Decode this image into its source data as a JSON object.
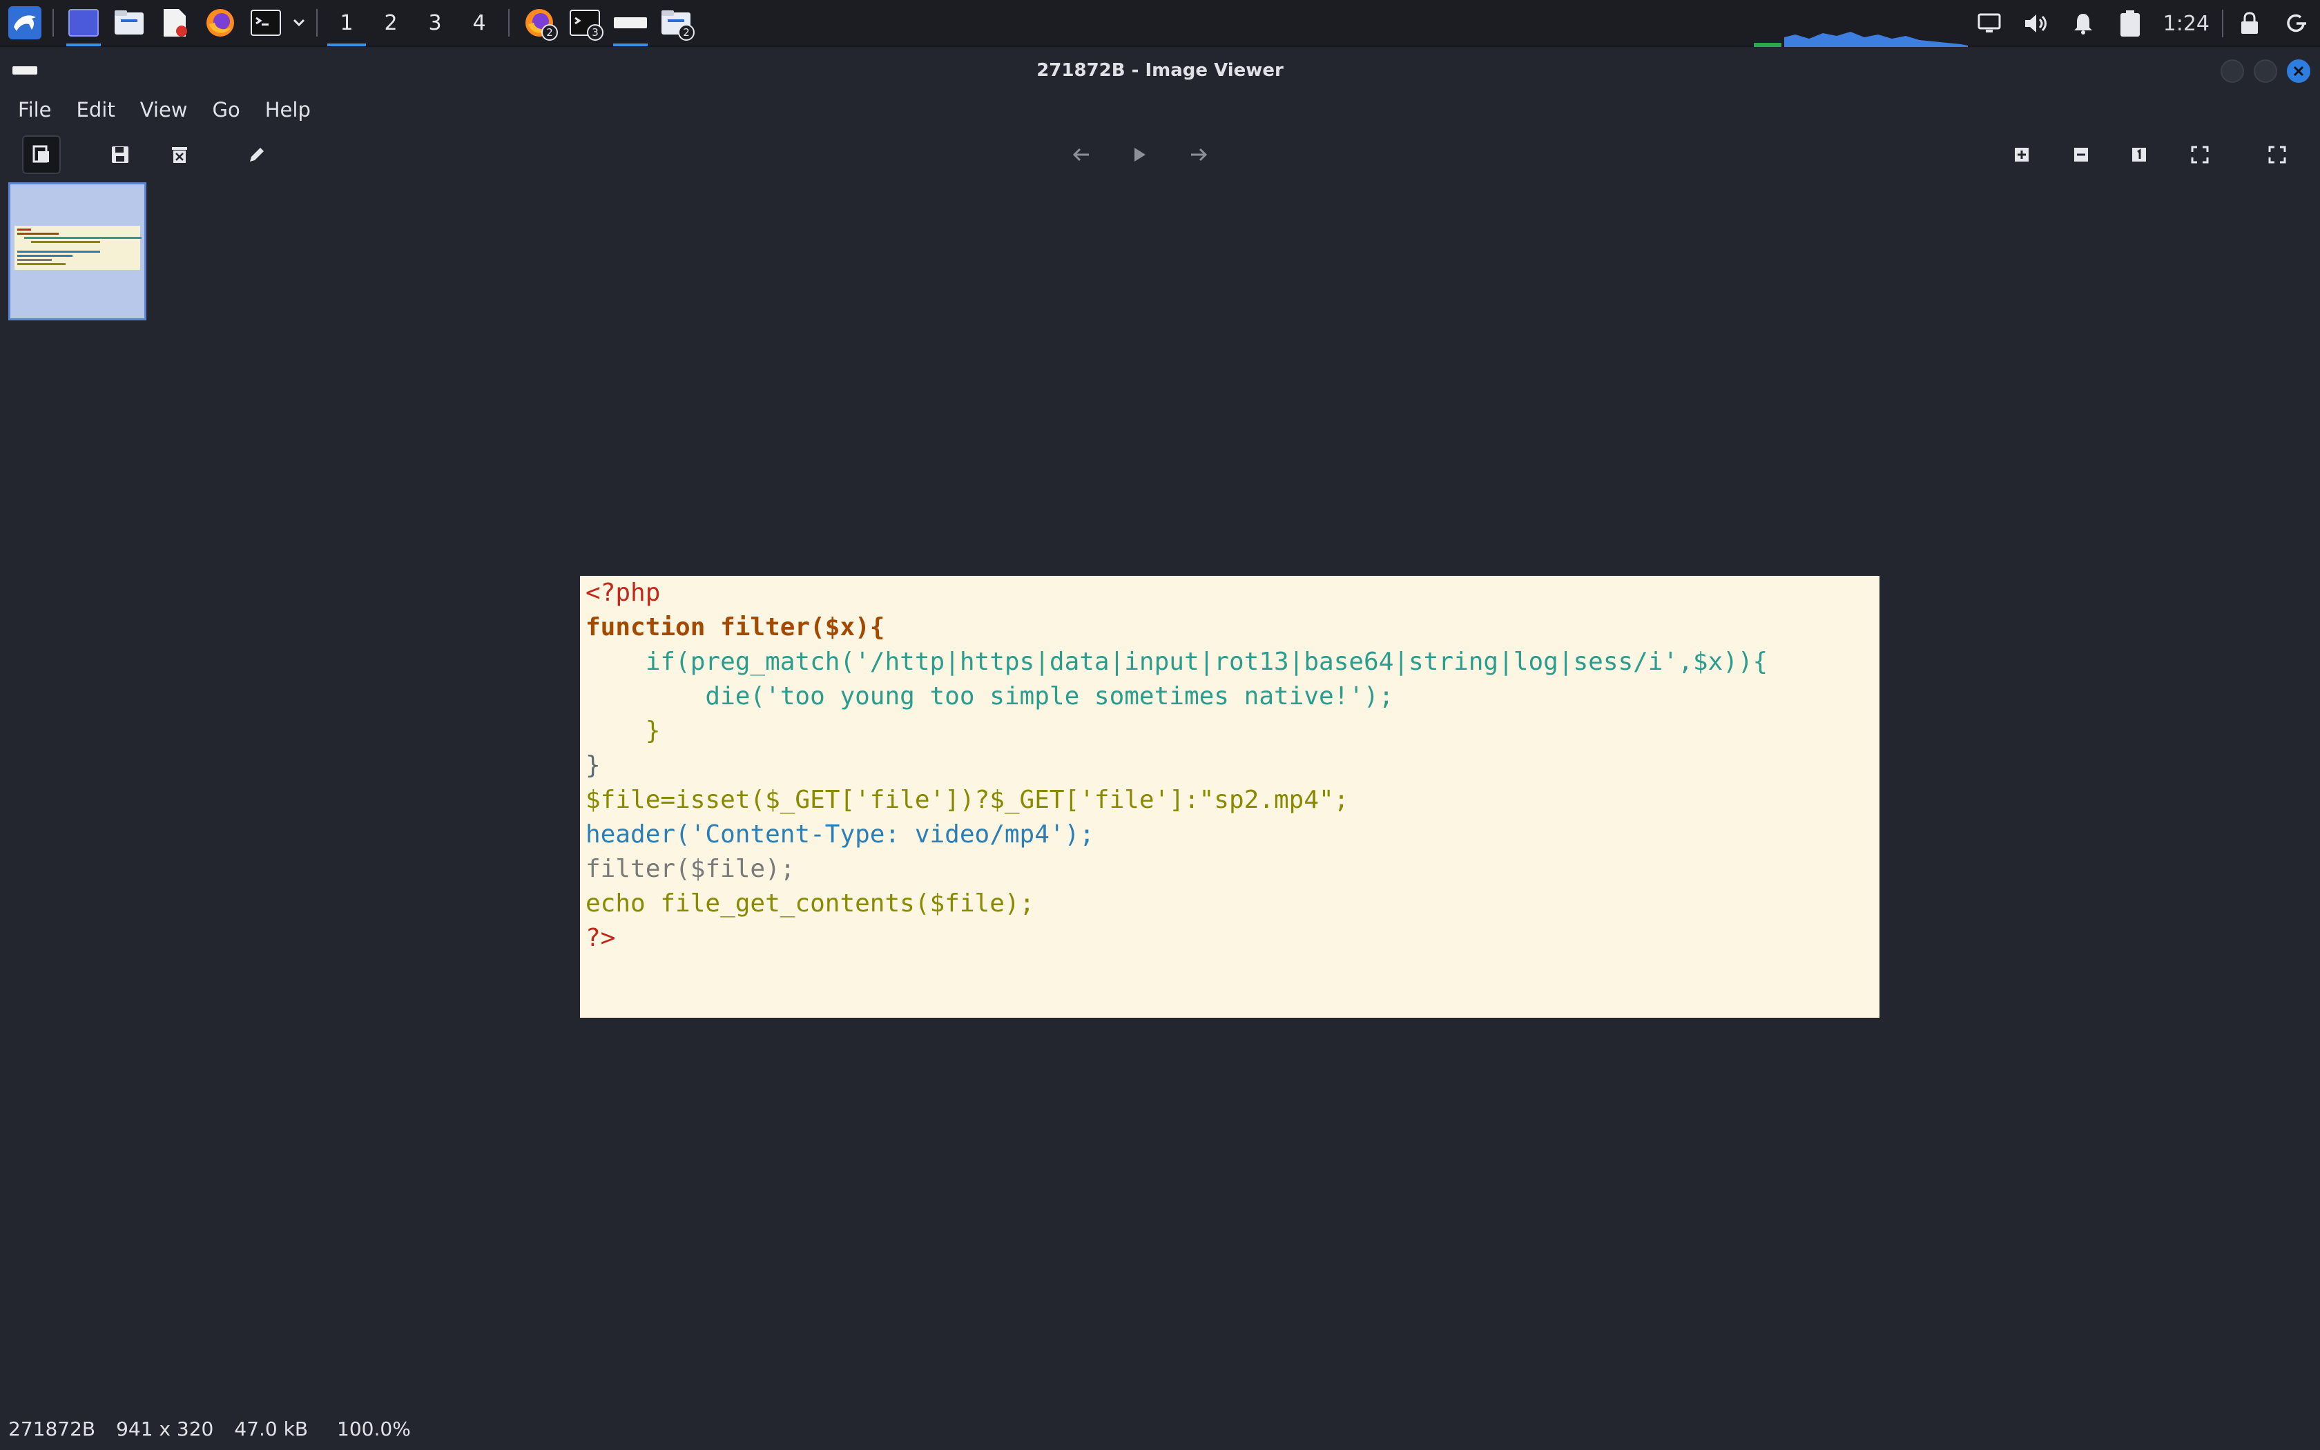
{
  "taskbar": {
    "workspaces": [
      "1",
      "2",
      "3",
      "4"
    ],
    "active_workspace": "1",
    "firefox_badge": "2",
    "terminal_badge": "3",
    "files_badge": "2",
    "clock": "1:24",
    "accent": "#3d8ee6"
  },
  "window": {
    "title": "271872B - Image Viewer"
  },
  "menu": {
    "items": [
      "File",
      "Edit",
      "View",
      "Go",
      "Help"
    ]
  },
  "code": {
    "lines": [
      "<?php",
      "function filter($x){",
      "    if(preg_match('/http|https|data|input|rot13|base64|string|log|sess/i',$x)){",
      "        die('too young too simple sometimes native!');",
      "    }",
      "}",
      "$file=isset($_GET['file'])?$_GET['file']:\"sp2.mp4\";",
      "header('Content-Type: video/mp4');",
      "filter($file);",
      "echo file_get_contents($file);",
      "?>"
    ]
  },
  "status": {
    "filename": "271872B",
    "dimensions": "941 x 320",
    "filesize": "47.0 kB",
    "zoom": "100.0%"
  }
}
